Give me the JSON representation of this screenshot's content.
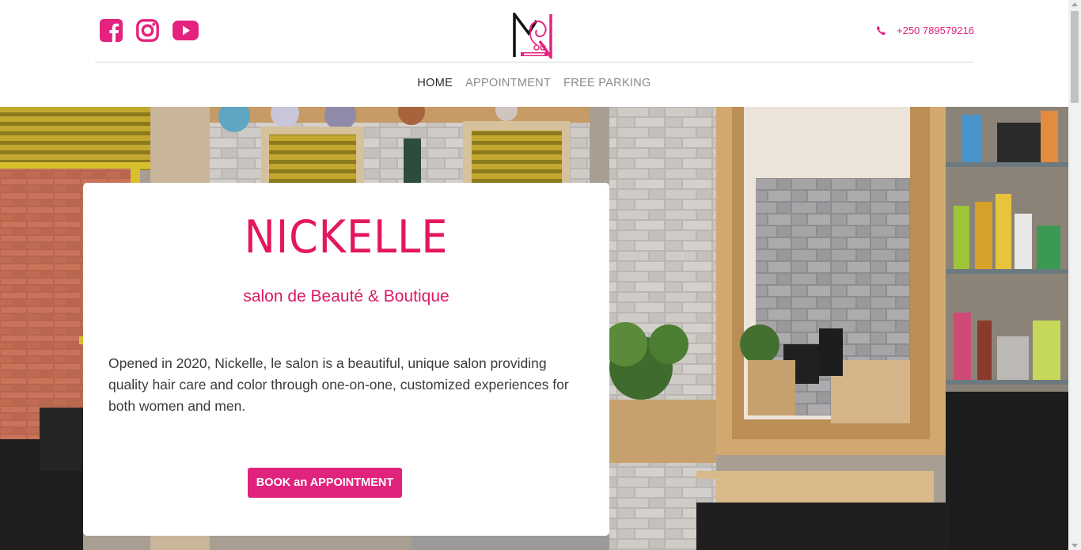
{
  "header": {
    "social": [
      "facebook-icon",
      "instagram-icon",
      "youtube-icon"
    ],
    "phone_icon": "phone-icon",
    "phone": "+250 789579216",
    "logo_icon": "salon-logo"
  },
  "nav": {
    "items": [
      {
        "label": "HOME",
        "active": true
      },
      {
        "label": "APPOINTMENT",
        "active": false
      },
      {
        "label": "FREE PARKING",
        "active": false
      }
    ]
  },
  "hero": {
    "title": "NICKELLE",
    "subtitle": "salon de Beauté & Boutique",
    "description": "Opened in 2020, Nickelle, le salon is a beautiful, unique salon providing quality hair care and color through one-on-one, customized experiences for both women and men.",
    "cta": "BOOK an APPOINTMENT"
  },
  "colors": {
    "accent": "#e4237f",
    "title": "#e4165f",
    "nav_active": "#2a2a2a",
    "nav_inactive": "#8a8a8a"
  }
}
